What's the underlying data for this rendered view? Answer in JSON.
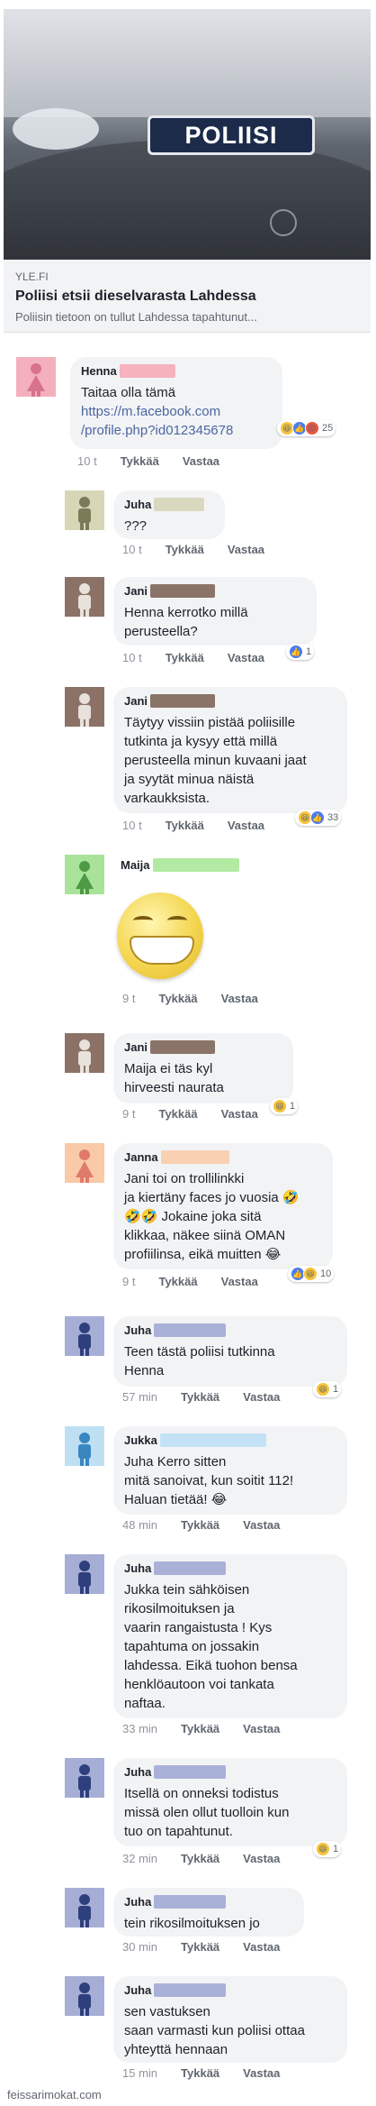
{
  "link_preview": {
    "hero_sign_text": "POLIISI",
    "source": "YLE.FI",
    "title": "Poliisi etsii dieselvarasta Lahdessa",
    "description": "Poliisin tietoon on tullut Lahdessa tapahtunut..."
  },
  "action_labels": {
    "like": "Tykkää",
    "reply": "Vastaa"
  },
  "comments": [
    {
      "author": "Henna",
      "avatar_color": "#f4b0bd",
      "figure_color": "#d9728c",
      "redact_color": "#f6b2bd",
      "text": "Taitaa olla tämä",
      "link": "https://m.facebook.com\n/profile.php?id012345678",
      "time": "10 t",
      "reactions": [
        "haha",
        "like",
        "angry"
      ],
      "reaction_count": "25"
    },
    {
      "author": "Juha",
      "avatar_color": "#d7d7b8",
      "figure_color": "#7b7b58",
      "redact_color": "#d9d9c0",
      "text": "???",
      "time": "10 t",
      "reactions": [],
      "reaction_count": ""
    },
    {
      "author": "Jani",
      "avatar_color": "#8c7266",
      "figure_color": "#e8e1dc",
      "redact_color": "#8a7468",
      "text": "Henna kerrotko millä\nperusteella?",
      "time": "10 t",
      "reactions": [
        "like"
      ],
      "reaction_count": "1"
    },
    {
      "author": "Jani",
      "avatar_color": "#8c7266",
      "figure_color": "#e8e1dc",
      "redact_color": "#8a7468",
      "text": "Täytyy vissiin pistää poliisille\ntutkinta ja kysyy että millä\nperusteella minun kuvaani jaat\nja syytät minua näistä\nvarkaukksista.",
      "time": "10 t",
      "reactions": [
        "haha",
        "like"
      ],
      "reaction_count": "33"
    },
    {
      "author": "Maija",
      "avatar_color": "#a9e39a",
      "figure_color": "#4f9a45",
      "redact_color": "#b2eaa3",
      "text": "",
      "time": "9 t",
      "reactions": [],
      "reaction_count": ""
    },
    {
      "author": "Jani",
      "avatar_color": "#8c7266",
      "figure_color": "#e8e1dc",
      "redact_color": "#8a7468",
      "text": "Maija ei täs kyl\nhirveesti naurata",
      "time": "9 t",
      "reactions": [
        "haha"
      ],
      "reaction_count": "1"
    },
    {
      "author": "Janna",
      "avatar_color": "#f9c9a8",
      "figure_color": "#e07a6b",
      "redact_color": "#fad0b3",
      "text": "Jani toi on trollilinkki\nja kiertäny faces jo vuosia 🤣\n🤣🤣 Jokaine joka sitä\nklikkaa, näkee siinä OMAN\nprofiilinsa, eikä muitten 😂",
      "time": "9 t",
      "reactions": [
        "like",
        "haha"
      ],
      "reaction_count": "10"
    },
    {
      "author": "Juha",
      "avatar_color": "#a7aed6",
      "figure_color": "#2e3f7d",
      "redact_color": "#aab1d8",
      "text": "Teen tästä poliisi tutkinna\nHenna",
      "time": "57 min",
      "reactions": [
        "haha"
      ],
      "reaction_count": "1"
    },
    {
      "author": "Jukka",
      "avatar_color": "#bfe0f3",
      "figure_color": "#3a86bf",
      "redact_color": "#c3e2f5",
      "text": "Juha Kerro sitten\nmitä sanoivat, kun soitit 112!\nHaluan tietää! 😂",
      "time": "48 min",
      "reactions": [],
      "reaction_count": ""
    },
    {
      "author": "Juha",
      "avatar_color": "#a7aed6",
      "figure_color": "#2e3f7d",
      "redact_color": "#aab1d8",
      "text": "Jukka tein sähköisen\nrikosilmoituksen ja\nvaarin rangaistusta ! Kys\ntapahtuma on jossakin\nlahdessa. Eikä tuohon bensa\nhenklöautoon voi tankata\nnaftaa.",
      "time": "33 min",
      "reactions": [],
      "reaction_count": ""
    },
    {
      "author": "Juha",
      "avatar_color": "#a7aed6",
      "figure_color": "#2e3f7d",
      "redact_color": "#aab1d8",
      "text": "Itsellä on onneksi todistus\nmissä olen ollut tuolloin kun\ntuo on tapahtunut.",
      "time": "32 min",
      "reactions": [
        "haha"
      ],
      "reaction_count": "1"
    },
    {
      "author": "Juha",
      "avatar_color": "#a7aed6",
      "figure_color": "#2e3f7d",
      "redact_color": "#aab1d8",
      "text": "tein rikosilmoituksen jo",
      "time": "30 min",
      "reactions": [],
      "reaction_count": ""
    },
    {
      "author": "Juha",
      "avatar_color": "#a7aed6",
      "figure_color": "#2e3f7d",
      "redact_color": "#aab1d8",
      "text": "sen vastuksen\nsaan varmasti kun poliisi ottaa\nyhteyttä hennaan",
      "time": "15 min",
      "reactions": [],
      "reaction_count": ""
    }
  ],
  "footer": {
    "watermark": "feissarimokat.com"
  }
}
